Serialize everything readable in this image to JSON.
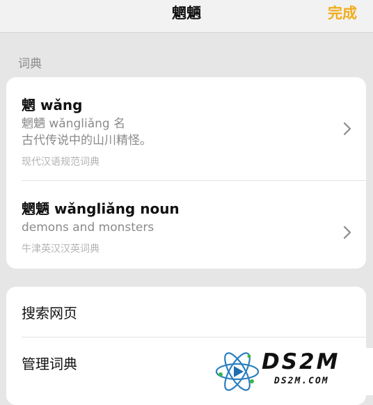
{
  "navbar": {
    "title": "魍魉",
    "done_label": "完成"
  },
  "section_label": "词典",
  "entries": [
    {
      "headword": "魍 wǎng",
      "desc_lines": [
        "魍魉 wǎngliǎng 名",
        "古代传说中的山川精怪。"
      ],
      "source": "现代汉语规范词典"
    },
    {
      "headword": "魍魉 wǎngliǎng noun",
      "desc_lines": [
        "demons and monsters"
      ],
      "source": "牛津英汉汉英词典"
    }
  ],
  "actions": [
    {
      "label": "搜索网页"
    },
    {
      "label": "管理词典"
    }
  ],
  "watermark": {
    "brand": "DS2M",
    "domain": "DS2M.COM"
  },
  "colors": {
    "accent": "#f0ad1a",
    "background": "#e6e6e6",
    "card": "#ffffff"
  }
}
